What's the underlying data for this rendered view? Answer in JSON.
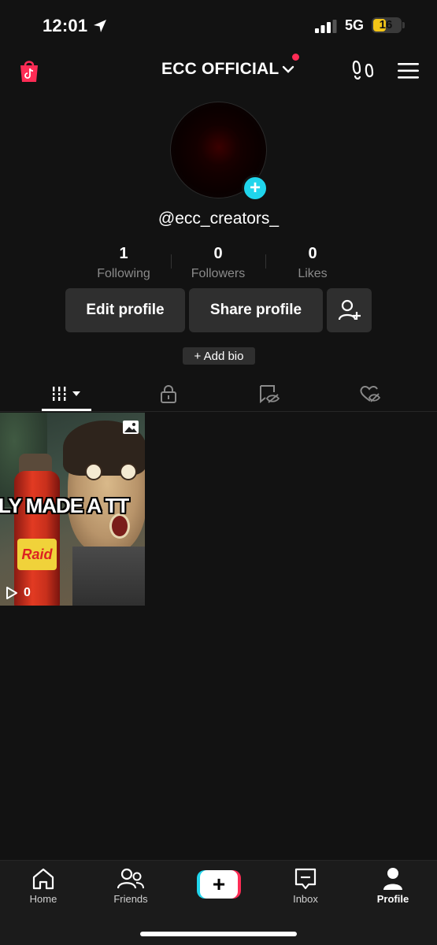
{
  "status_bar": {
    "time": "12:01",
    "network": "5G",
    "battery": "16",
    "battery_level": 0.16,
    "battery_color": "#f3c517"
  },
  "header": {
    "account_name": "ECC OFFICIAL",
    "notification_dot_color": "#fe2c55",
    "icons": [
      "shop-icon",
      "footprint-icon",
      "menu-icon"
    ]
  },
  "profile": {
    "handle": "@ecc_creators_",
    "stats": [
      {
        "value": "1",
        "label": "Following"
      },
      {
        "value": "0",
        "label": "Followers"
      },
      {
        "value": "0",
        "label": "Likes"
      }
    ],
    "edit_label": "Edit profile",
    "share_label": "Share profile",
    "add_bio_label": "+ Add bio",
    "accent_color": "#20d5ec"
  },
  "tabs": [
    {
      "name": "videos",
      "icon": "grid-icon",
      "active": true
    },
    {
      "name": "private",
      "icon": "lock-icon"
    },
    {
      "name": "reposts",
      "icon": "repost-hidden-icon"
    },
    {
      "name": "liked",
      "icon": "heart-hidden-icon"
    }
  ],
  "videos": [
    {
      "caption": "LY MADE A TT",
      "views": "0",
      "can_text": "Raid",
      "type_icon": "photo-icon"
    }
  ],
  "bottom_nav": [
    {
      "label": "Home",
      "icon": "home-icon"
    },
    {
      "label": "Friends",
      "icon": "friends-icon"
    },
    {
      "label": "",
      "icon": "create-plus-icon"
    },
    {
      "label": "Inbox",
      "icon": "inbox-icon"
    },
    {
      "label": "Profile",
      "icon": "profile-icon",
      "active": true
    }
  ]
}
